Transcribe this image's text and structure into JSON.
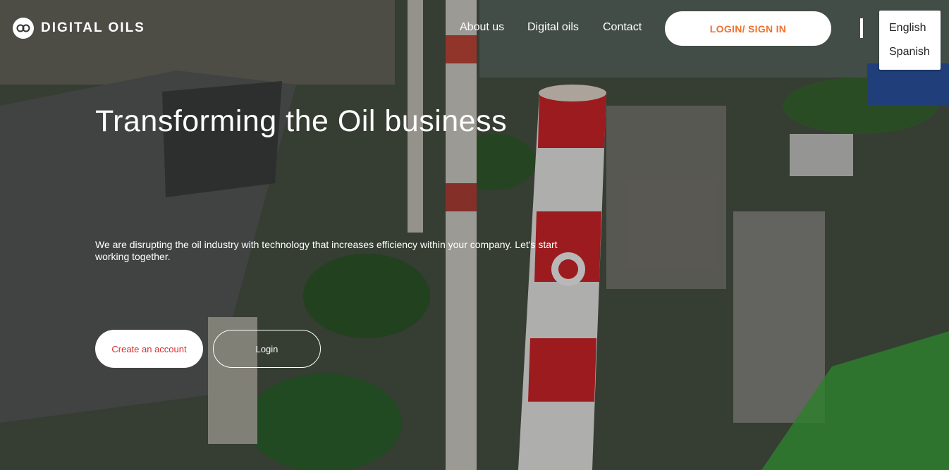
{
  "brand": {
    "name": "DIGITAL OILS"
  },
  "nav": {
    "items": [
      {
        "label": "About us"
      },
      {
        "label": "Digital oils"
      },
      {
        "label": "Contact"
      }
    ],
    "login_label": "LOGIN/ SIGN IN"
  },
  "language": {
    "options": [
      "English",
      "Spanish"
    ]
  },
  "hero": {
    "title": "Transforming the Oil business",
    "description": "We are disrupting the oil industry with technology that increases efficiency within your company. Let's start working together.",
    "create_label": "Create an account",
    "login_label": "Login"
  },
  "colors": {
    "accent_orange": "#f0712b",
    "accent_red": "#d32f2f"
  }
}
